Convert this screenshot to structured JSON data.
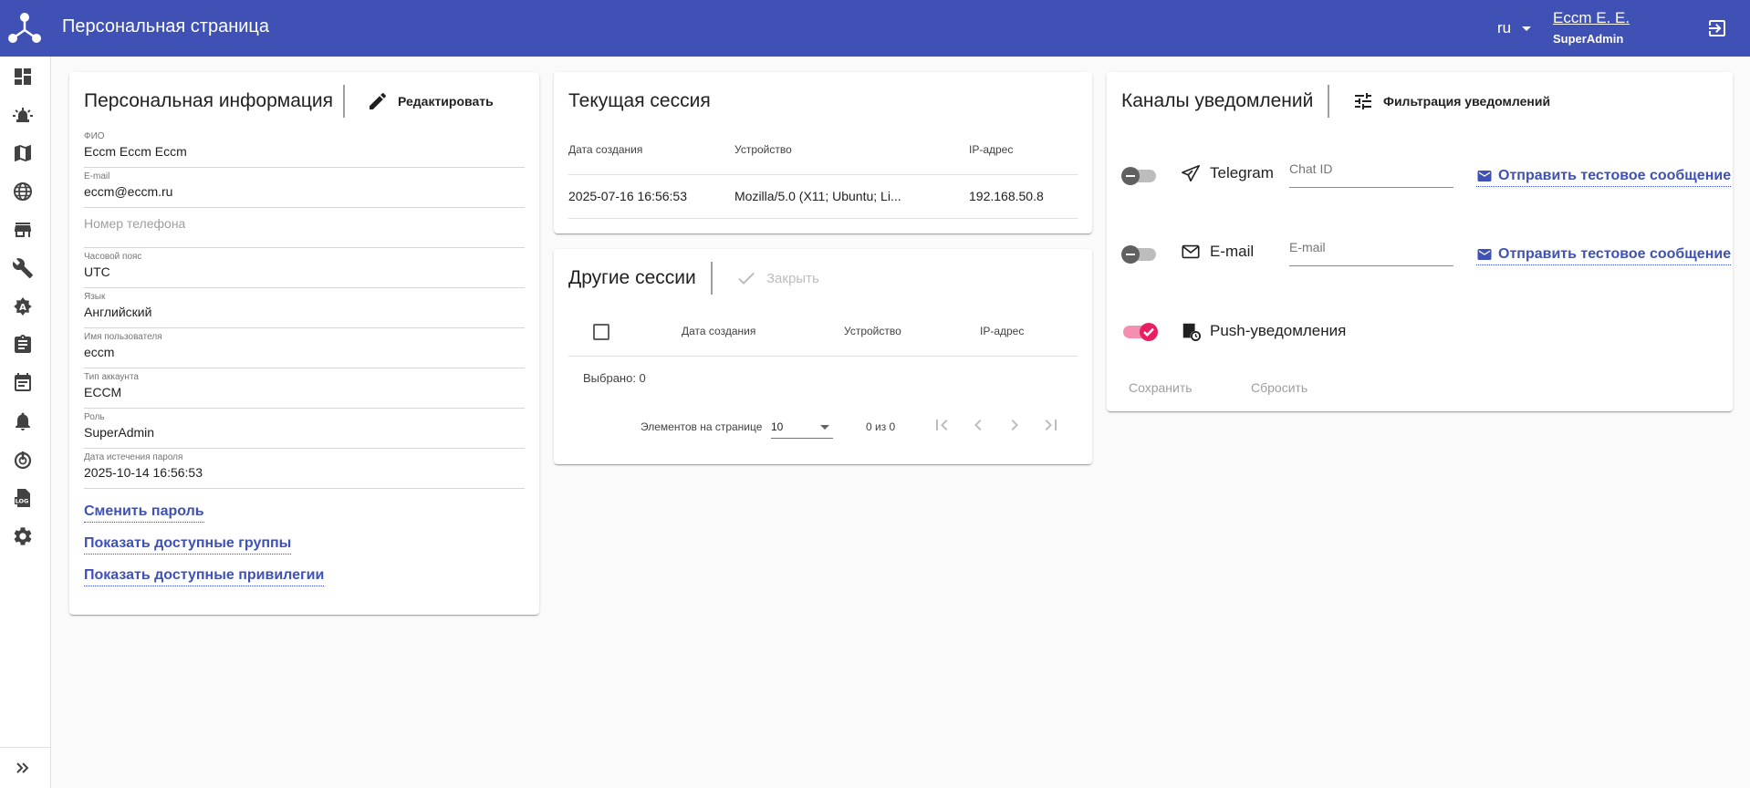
{
  "app": {
    "title": "Персональная страница",
    "language": "ru",
    "user_name": "Eccm E. E.",
    "user_role": "SuperAdmin"
  },
  "sidebar": {
    "icons": [
      "dashboard-icon",
      "alarm-icon",
      "map-icon",
      "globe-icon",
      "store-icon",
      "wrench-icon",
      "auto-fix-icon",
      "clipboard-icon",
      "calendar-icon",
      "bell-icon",
      "power-icon",
      "log-file-icon",
      "settings-icon"
    ],
    "expand_icon": "double-chevron-right-icon"
  },
  "personal": {
    "title": "Персональная информация",
    "edit_label": "Редактировать",
    "fields": [
      {
        "label": "ФИО",
        "value": "Eccm Eccm Eccm"
      },
      {
        "label": "E-mail",
        "value": "eccm@eccm.ru"
      },
      {
        "label": "",
        "value": "",
        "placeholder": "Номер телефона"
      },
      {
        "label": "Часовой пояс",
        "value": "UTC"
      },
      {
        "label": "Язык",
        "value": "Английский"
      },
      {
        "label": "Имя пользователя",
        "value": "eccm"
      },
      {
        "label": "Тип аккаунта",
        "value": "ECCM"
      },
      {
        "label": "Роль",
        "value": "SuperAdmin"
      },
      {
        "label": "Дата истечения пароля",
        "value": "2025-10-14 16:56:53"
      }
    ],
    "links": [
      "Сменить пароль",
      "Показать доступные группы",
      "Показать доступные привилегии"
    ]
  },
  "current_session": {
    "title": "Текущая сессия",
    "columns": [
      "Дата создания",
      "Устройство",
      "IP-адрес"
    ],
    "row": [
      "2025-07-16 16:56:53",
      "Mozilla/5.0 (X11; Ubuntu; Li...",
      "192.168.50.8"
    ]
  },
  "other_sessions": {
    "title": "Другие сессии",
    "close_label": "Закрыть",
    "columns": [
      "Дата создания",
      "Устройство",
      "IP-адрес"
    ],
    "selected": "Выбрано: 0",
    "per_page_label": "Элементов на странице",
    "per_page_value": "10",
    "range": "0 из 0"
  },
  "notifications": {
    "title": "Каналы уведомлений",
    "filter_label": "Фильтрация уведомлений",
    "telegram": {
      "label": "Telegram",
      "placeholder": "Chat ID",
      "send": "Отправить тестовое сообщение",
      "enabled": false
    },
    "email": {
      "label": "E-mail",
      "placeholder": "E-mail",
      "send": "Отправить тестовое сообщение",
      "enabled": false
    },
    "push": {
      "label": "Push-уведомления",
      "enabled": true
    },
    "save": "Сохранить",
    "reset": "Сбросить"
  },
  "colors": {
    "primary": "#3f51b5",
    "accent": "#e91e63",
    "background": "#fafafa"
  }
}
